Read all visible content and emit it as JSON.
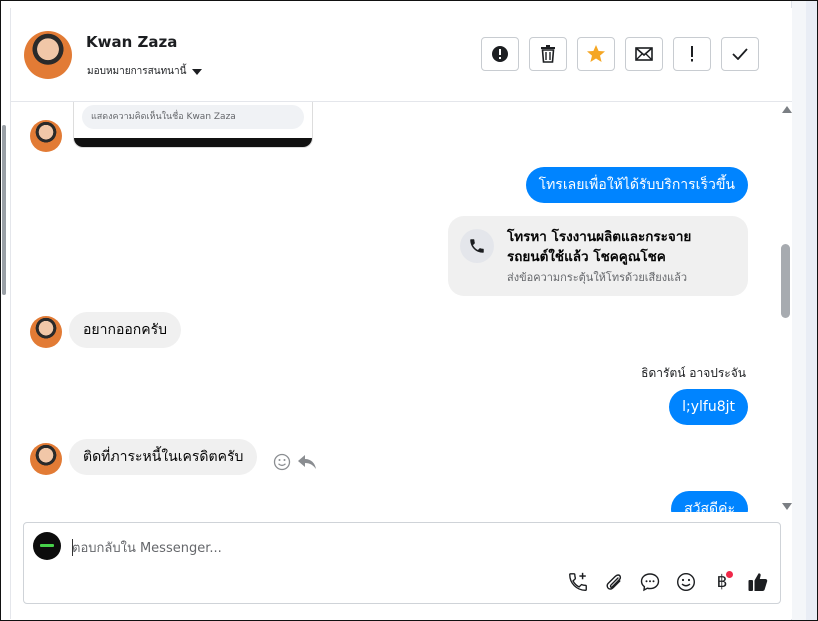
{
  "header": {
    "contact_name": "Kwan Zaza",
    "assign_label": "มอบหมายการสนทนานี้",
    "tools": [
      {
        "name": "mark-spam-icon"
      },
      {
        "name": "trash-icon"
      },
      {
        "name": "star-icon"
      },
      {
        "name": "envelope-icon"
      },
      {
        "name": "exclamation-icon"
      },
      {
        "name": "check-icon"
      }
    ]
  },
  "colors": {
    "accent": "#0084ff",
    "star": "#f5a623",
    "incoming_bubble": "#f0f0f0",
    "notification": "#f02849"
  },
  "chat": {
    "preview_comment_placeholder": "แสดงความคิดเห็นในชื่อ Kwan Zaza",
    "messages": [
      {
        "direction": "out",
        "text": "โทรเลยเพื่อให้ได้รับบริการเร็วขึ้น"
      },
      {
        "direction": "out",
        "type": "call_card",
        "title": "โทรหา โรงงานผลิตและกระจาย รถยนต์ใช้แล้ว โชคคูณโชค",
        "subtitle": "ส่งข้อความกระตุ้นให้โทรด้วยเสียงแล้ว"
      },
      {
        "direction": "in",
        "text": "อยากออกครับ"
      },
      {
        "direction": "out",
        "sender": "ธิดารัตน์ อาจประจัน",
        "text": "l;ylfu8jt"
      },
      {
        "direction": "in",
        "text": "ติดที่ภาระหนี้ในเครดิตครับ"
      },
      {
        "direction": "out",
        "text": "สวัสดีค่ะ"
      }
    ]
  },
  "composer": {
    "placeholder": "ตอบกลับใน Messenger...",
    "currency_symbol": "฿"
  }
}
